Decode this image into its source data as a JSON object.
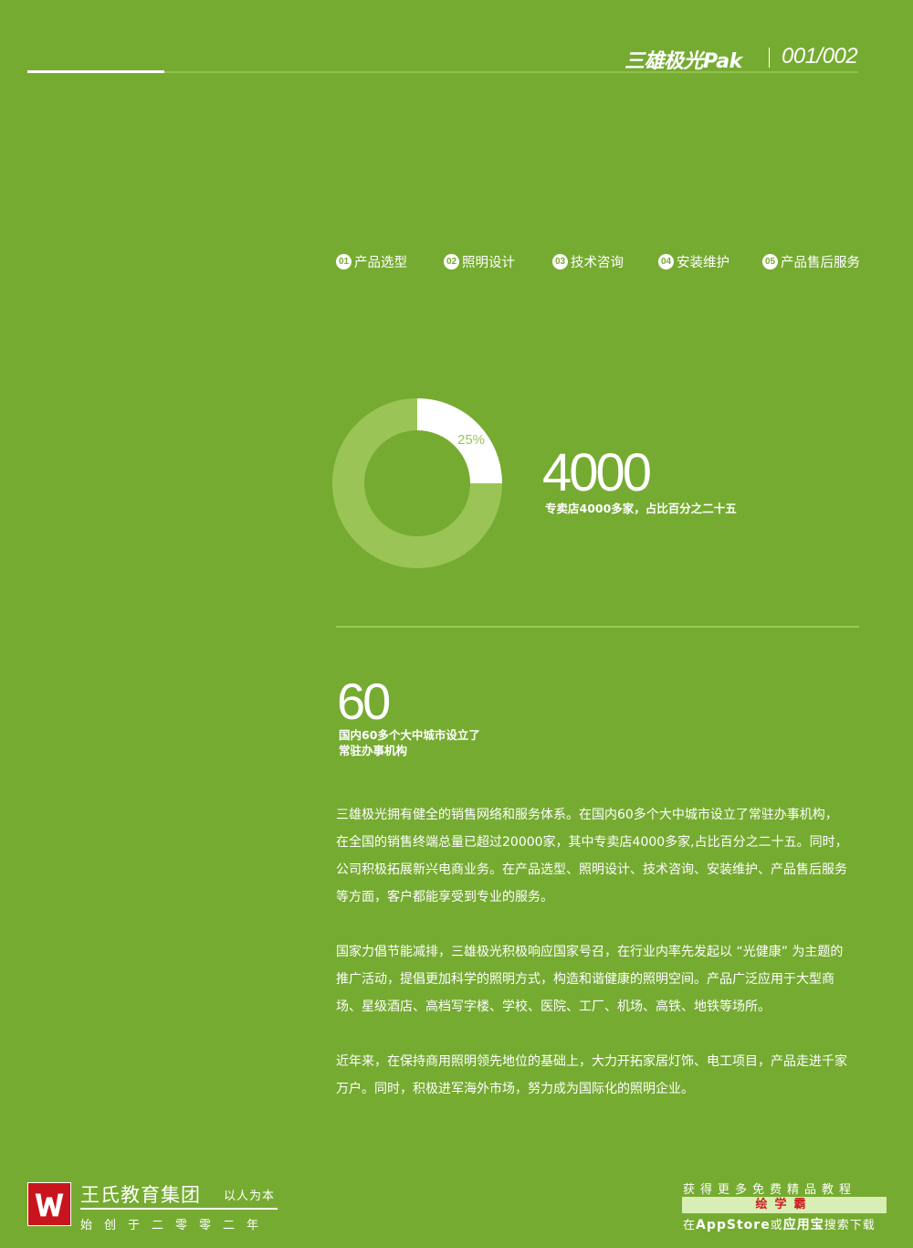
{
  "header": {
    "brand": "三雄极光Pak",
    "page": "001/002"
  },
  "tabs": [
    {
      "num": "01",
      "label": "产品选型"
    },
    {
      "num": "02",
      "label": "照明设计"
    },
    {
      "num": "03",
      "label": "技术咨询"
    },
    {
      "num": "04",
      "label": "安装维护"
    },
    {
      "num": "05",
      "label": "产品售后服务"
    }
  ],
  "chart_data": {
    "type": "pie",
    "slices": [
      {
        "label": "25%",
        "value": 25,
        "color": "#ffffff"
      },
      {
        "label": "",
        "value": 75,
        "color": "#9bc457"
      }
    ]
  },
  "stat1": {
    "value": "4000",
    "caption": "专卖店4000多家，占比百分之二十五"
  },
  "stat2": {
    "value": "60",
    "caption_line1": "国内60多个大中城市设立了",
    "caption_line2": "常驻办事机构"
  },
  "paragraphs": [
    "三雄极光拥有健全的销售网络和服务体系。在国内60多个大中城市设立了常驻办事机构，\n在全国的销售终端总量已超过20000家，其中专卖店4000多家,占比百分之二十五。同时，\n公司积极拓展新兴电商业务。在产品选型、照明设计、技术咨询、安装维护、产品售后服务\n等方面，客户都能享受到专业的服务。",
    "国家力倡节能减排，三雄极光积极响应国家号召，在行业内率先发起以 “光健康” 为主题的\n推广活动，提倡更加科学的照明方式，构造和谐健康的照明空间。产品广泛应用于大型商\n场、星级酒店、高档写字楼、学校、医院、工厂、机场、高铁、地铁等场所。",
    "近年来，在保持商用照明领先地位的基础上，大力开拓家居灯饰、电工项目，产品走进千家\n万户。同时，积极进军海外市场，努力成为国际化的照明企业。"
  ],
  "footer": {
    "org_name": "王氏教育集团",
    "slogan": "以人为本",
    "founded": "始创于二零零二年",
    "promo_top": "获得更多免费精品教程",
    "promo_app": "绘学霸",
    "promo_bottom_pre": "在",
    "promo_store1": "AppStore",
    "promo_mid": "或",
    "promo_store2": "应用宝",
    "promo_bottom_post": "搜索下载"
  },
  "colors": {
    "background": "#76ab32",
    "ring_light": "#9bc457",
    "logo_red": "#c8151d"
  }
}
